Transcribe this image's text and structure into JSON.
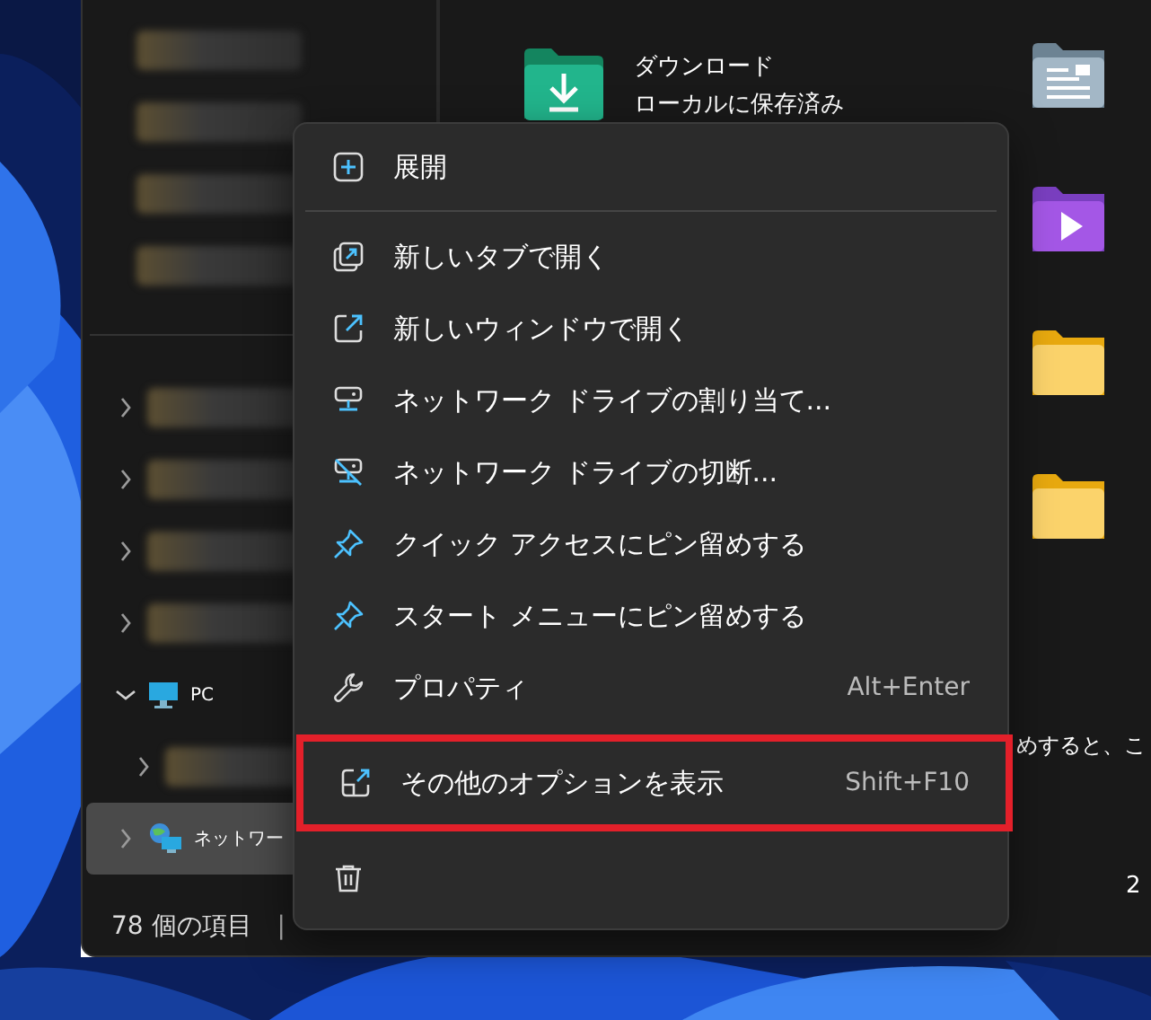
{
  "sidebar": {
    "quick_access": [
      {
        "kind": "blurred",
        "selected": false
      },
      {
        "kind": "blurred",
        "selected": false
      },
      {
        "kind": "blurred",
        "selected": false
      },
      {
        "kind": "blurred",
        "selected": false
      }
    ],
    "tree": [
      {
        "kind": "blurred",
        "expanded": false,
        "selected": false
      },
      {
        "kind": "blurred",
        "expanded": false,
        "selected": false
      },
      {
        "kind": "blurred",
        "expanded": false,
        "selected": false
      },
      {
        "kind": "blurred",
        "expanded": false,
        "selected": false
      },
      {
        "kind": "pc",
        "label": "PC",
        "expanded": true,
        "selected": false,
        "children": [
          {
            "kind": "blurred",
            "expanded": false,
            "selected": false
          }
        ]
      },
      {
        "kind": "network",
        "label": "ネットワー",
        "expanded": false,
        "selected": true
      }
    ]
  },
  "content": {
    "files": [
      {
        "kind": "download",
        "name": "ダウンロード",
        "status": "ローカルに保存済み"
      }
    ],
    "column_2": [
      {
        "kind": "documents"
      },
      {
        "kind": "videos"
      },
      {
        "kind": "folder"
      },
      {
        "kind": "folder"
      }
    ],
    "peek_texts": [
      "めすると、こ",
      "2"
    ]
  },
  "status_bar": {
    "count": "78 個の項目",
    "separator": "|"
  },
  "context_menu": {
    "items": [
      {
        "kind": "expand",
        "label": "展開",
        "highlighted": false
      },
      {
        "kind": "separator"
      },
      {
        "kind": "new_tab",
        "label": "新しいタブで開く",
        "highlighted": false
      },
      {
        "kind": "new_window",
        "label": "新しいウィンドウで開く",
        "highlighted": false
      },
      {
        "kind": "map_drive",
        "label": "ネットワーク ドライブの割り当て...",
        "highlighted": false
      },
      {
        "kind": "disconnect_drive",
        "label": "ネットワーク ドライブの切断...",
        "highlighted": false
      },
      {
        "kind": "pin",
        "label": "クイック アクセスにピン留めする",
        "highlighted": false
      },
      {
        "kind": "pin",
        "label": "スタート メニューにピン留めする",
        "highlighted": false
      },
      {
        "kind": "properties",
        "label": "プロパティ",
        "shortcut": "Alt+Enter",
        "highlighted": false
      },
      {
        "kind": "more_options",
        "label": "その他のオプションを表示",
        "shortcut": "Shift+F10",
        "highlighted": true
      },
      {
        "kind": "delete",
        "highlighted": false
      }
    ]
  }
}
